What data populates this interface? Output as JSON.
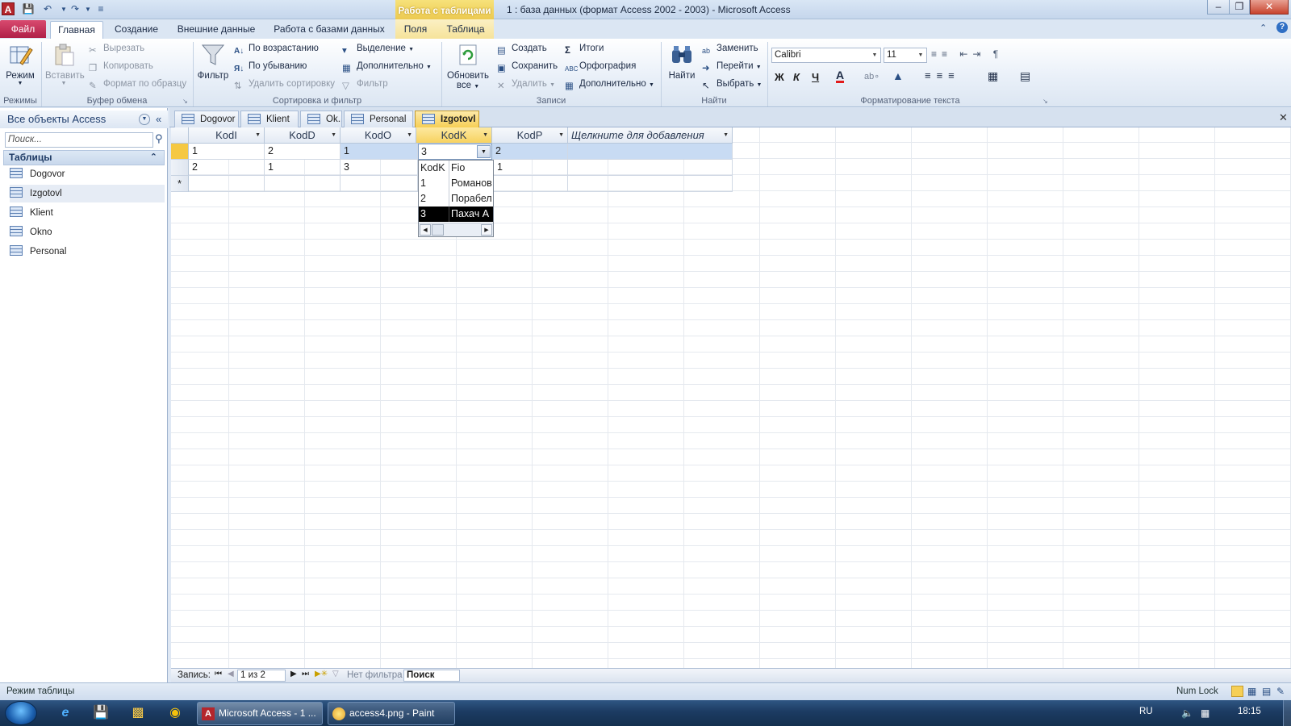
{
  "window": {
    "title": "1 : база данных (формат Access 2002 - 2003)  -  Microsoft Access",
    "context_group": "Работа с таблицами",
    "app_letter": "A"
  },
  "ribbon": {
    "file_tab": "Файл",
    "tabs": [
      "Главная",
      "Создание",
      "Внешние данные",
      "Работа с базами данных",
      "Поля",
      "Таблица"
    ],
    "groups": {
      "views": {
        "label": "Режимы",
        "view": "Режим"
      },
      "clipboard": {
        "label": "Буфер обмена",
        "paste": "Вставить",
        "cut": "Вырезать",
        "copy": "Копировать",
        "format_painter": "Формат по образцу"
      },
      "sort_filter": {
        "label": "Сортировка и фильтр",
        "filter": "Фильтр",
        "ascending": "По возрастанию",
        "descending": "По убыванию",
        "remove_sort": "Удалить сортировку",
        "selection": "Выделение",
        "advanced": "Дополнительно",
        "toggle_filter": "Фильтр"
      },
      "records": {
        "label": "Записи",
        "refresh_1": "Обновить",
        "refresh_2": "все",
        "new": "Создать",
        "save": "Сохранить",
        "delete": "Удалить",
        "totals": "Итоги",
        "spelling": "Орфография",
        "more": "Дополнительно"
      },
      "find": {
        "label": "Найти",
        "find": "Найти",
        "replace": "Заменить",
        "goto": "Перейти",
        "select": "Выбрать"
      },
      "text_format": {
        "label": "Форматирование текста",
        "font": "Calibri",
        "size": "11",
        "bold": "Ж",
        "italic": "К",
        "underline": "Ч"
      }
    }
  },
  "nav": {
    "header": "Все объекты Access",
    "search_placeholder": "Поиск...",
    "group": "Таблицы",
    "items": [
      "Dogovor",
      "Izgotovl",
      "Klient",
      "Okno",
      "Personal"
    ]
  },
  "doc_tabs": [
    "Dogovor",
    "Klient",
    "Ok...",
    "Personal",
    "Izgotovl"
  ],
  "table": {
    "columns": [
      "KodI",
      "KodD",
      "KodO",
      "KodK",
      "KodP",
      "Щелкните для добавления"
    ],
    "rows": [
      [
        "1",
        "2",
        "1",
        "3",
        "2"
      ],
      [
        "2",
        "1",
        "3",
        "",
        "1"
      ]
    ],
    "new_row_marker": "*"
  },
  "dropdown": {
    "headers": [
      "KodK",
      "Fio"
    ],
    "rows": [
      [
        "1",
        "Романов"
      ],
      [
        "2",
        "Порабел"
      ],
      [
        "3",
        "Пахач А"
      ]
    ],
    "selected": "3"
  },
  "record_nav": {
    "label": "Запись:",
    "position": "1 из 2",
    "filter": "Нет фильтра",
    "search": "Поиск"
  },
  "status": {
    "left": "Режим таблицы",
    "numlock": "Num Lock"
  },
  "taskbar": {
    "access": "Microsoft Access - 1 ...",
    "paint": "access4.png - Paint",
    "lang": "RU",
    "time": "18:15"
  },
  "colors": {
    "accent": "#f6cf55",
    "file_tab": "#b02048",
    "selection": "#c8dbf3"
  }
}
